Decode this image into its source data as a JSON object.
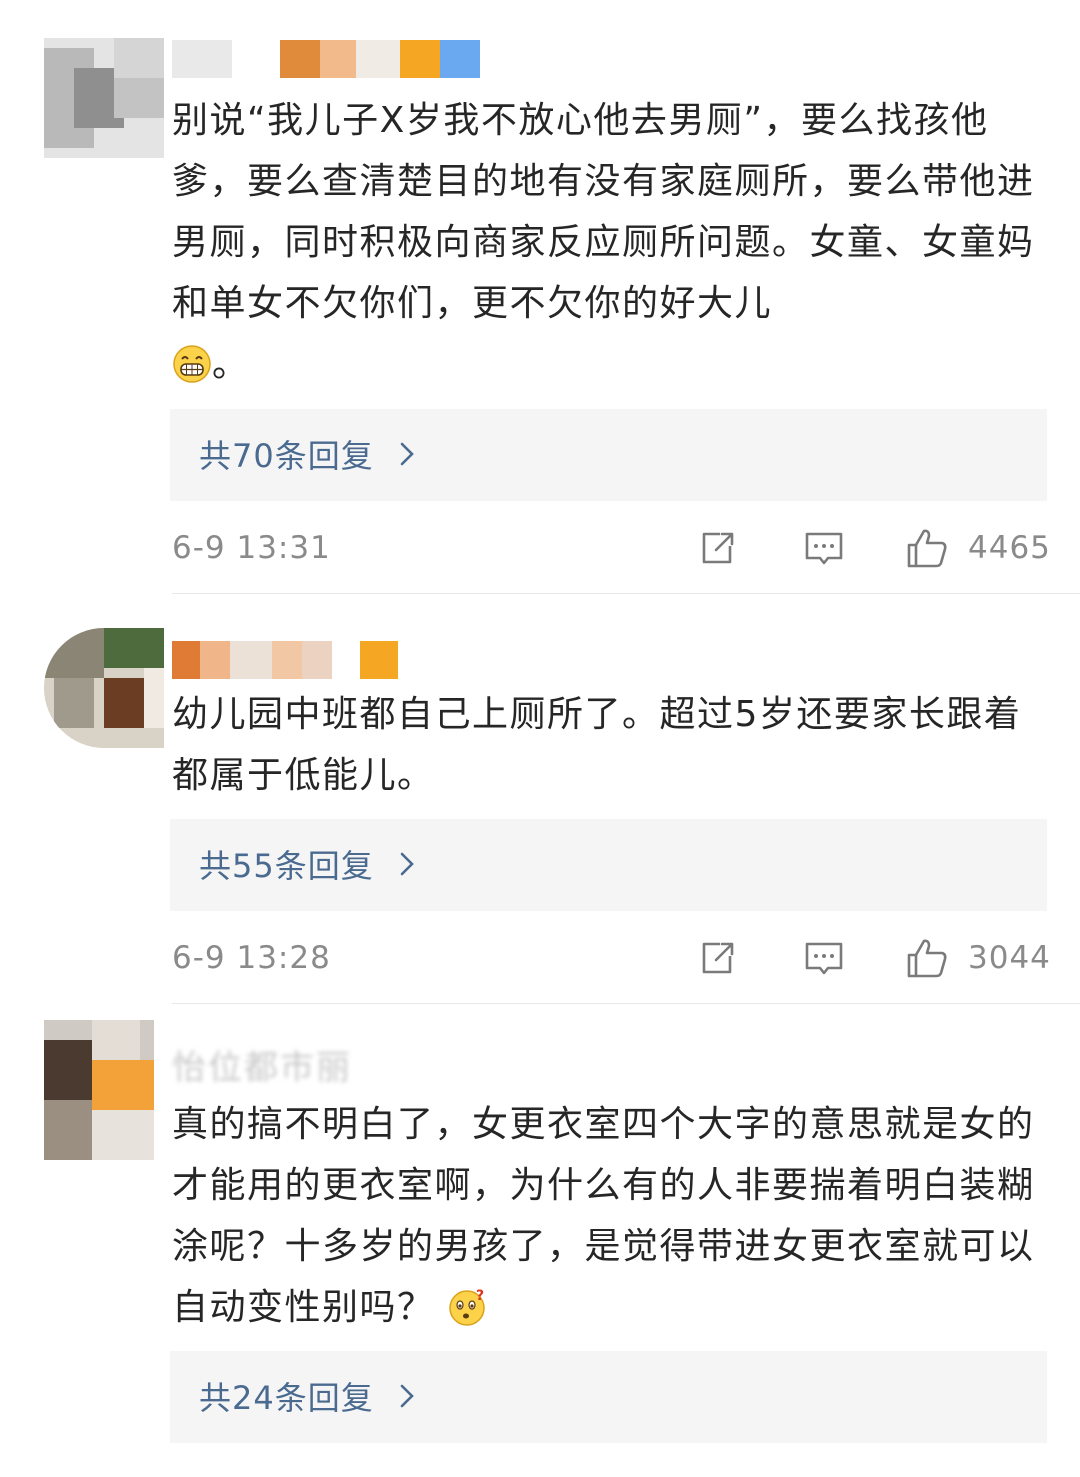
{
  "comments": [
    {
      "author": "",
      "text": "别说“我儿子X岁我不放心他去男厕”，要么找孩他爹，要么查清楚目的地有没有家庭厕所，要么带他进男厕，同时积极向商家反应厕所问题。女童、女童妈和单女不欠你们，更不欠你的好大儿",
      "emoji": "grinning-face-emoji",
      "text_after_emoji": "。",
      "replies_label": "共70条回复",
      "time": "6-9 13:31",
      "likes": "4465"
    },
    {
      "author": "",
      "text": "幼儿园中班都自己上厕所了。超过5岁还要家长跟着都属于低能儿。",
      "emoji": "",
      "text_after_emoji": "",
      "replies_label": "共55条回复",
      "time": "6-9 13:28",
      "likes": "3044"
    },
    {
      "author": "怡位都市丽",
      "text": "真的搞不明白了，女更衣室四个大字的意思就是女的才能用的更衣室啊，为什么有的人非要揣着明白装糊涂呢？十多岁的男孩了，是觉得带进女更衣室就可以自动变性别吗？",
      "emoji": "confused-face-emoji",
      "text_after_emoji": "",
      "replies_label": "共24条回复"
    }
  ],
  "icons": {
    "share": "share-icon",
    "comment": "comment-icon",
    "like": "thumbs-up-icon",
    "chevron": "chevron-right-icon"
  },
  "colors": {
    "reply_link": "#4a6a90",
    "meta_text": "#8a8a8a",
    "reply_bg": "#f5f5f5"
  }
}
